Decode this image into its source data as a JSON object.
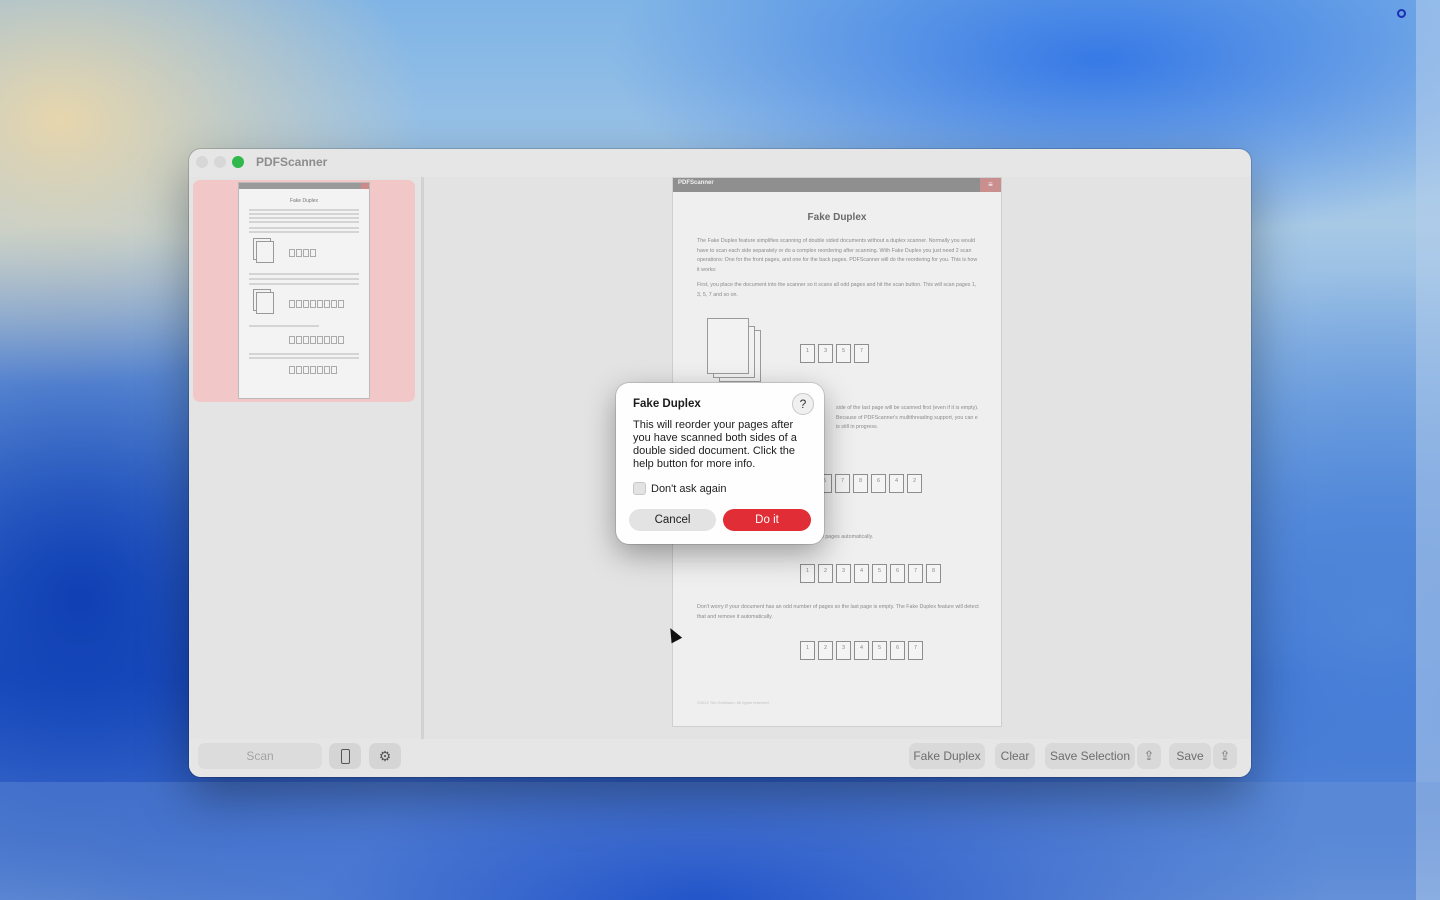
{
  "window": {
    "title": "PDFScanner"
  },
  "document": {
    "bar_label": "PDFScanner",
    "title": "Fake Duplex",
    "paragraph_1": "The Fake Duplex feature simplifies scanning of double sided documents  without a duplex scanner. Normally you would have to scan each side  separately or do a complex reordering after scanning. With Fake Duplex  you just need 2 scan operations: One for the front pages, and one for  the back pages. PDFScanner will do the reordering for you. This is how  it works:",
    "paragraph_2": "First, you place the document into the scanner so it scans all odd pages  and hit the scan button. This will scan pages 1, 3, 5, 7 and so on.",
    "paragraph_3_visible": "side of the last  page will be scanned first (even if it is empty). Because of PDFScanner's  multithreading support, you can e is still in progress.",
    "paragraph_4_visible": "he pages automatically.",
    "paragraph_5": "Don't worry if your document has an odd number of pages so the last page  is empty. The Fake Duplex feature will detect that and remove it  automatically.",
    "row_odd": [
      "1",
      "3",
      "5",
      "7"
    ],
    "row_mixed": [
      "5",
      "7",
      "8",
      "6",
      "4",
      "2"
    ],
    "row_ordered": [
      "1",
      "2",
      "3",
      "4",
      "5",
      "6",
      "7",
      "8"
    ],
    "row_final": [
      "1",
      "2",
      "3",
      "4",
      "5",
      "6",
      "7"
    ],
    "footer": "©2012 Tim Gollmann. All rights reserved."
  },
  "toolbar": {
    "scan": "Scan",
    "fake_duplex": "Fake Duplex",
    "clear": "Clear",
    "save_selection": "Save Selection",
    "save": "Save"
  },
  "dialog": {
    "title": "Fake Duplex",
    "help": "?",
    "message": "This will reorder your pages after you have scanned both sides of a double sided document. Click the help button for more info.",
    "checkbox_label": "Don't ask again",
    "cancel": "Cancel",
    "confirm": "Do it"
  },
  "colors": {
    "accent_red": "#e12d35",
    "thumbnail_selected": "#f2c7c8",
    "zoom_green": "#2fb84b"
  }
}
